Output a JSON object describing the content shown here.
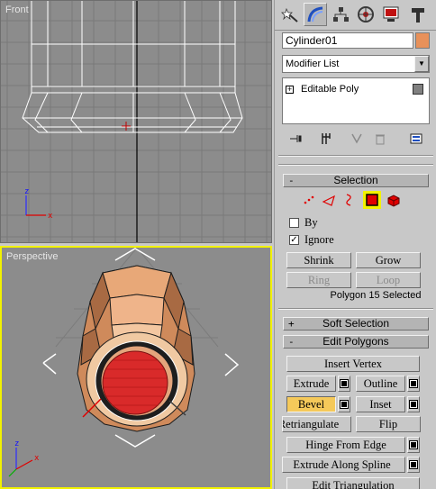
{
  "viewports": {
    "front_label": "Front",
    "perspective_label": "Perspective",
    "axis_x": "x",
    "axis_z": "z"
  },
  "command_panel": {
    "tabs": [
      {
        "name": "create",
        "icon": "star-wand-icon"
      },
      {
        "name": "modify",
        "icon": "bend-icon"
      },
      {
        "name": "hierarchy",
        "icon": "hierarchy-icon"
      },
      {
        "name": "motion",
        "icon": "motion-wheel-icon"
      },
      {
        "name": "display",
        "icon": "monitor-icon"
      },
      {
        "name": "utilities",
        "icon": "hammer-icon"
      }
    ],
    "object_name": "Cylinder01",
    "object_color": "#e8915a",
    "modifier_list": "Modifier List",
    "stack_item": "Editable Poly",
    "stack_expander": "+",
    "accent_selected": "#f2f200",
    "pressed_color": "#f5c95a"
  },
  "selection": {
    "title": "Selection",
    "sign": "-",
    "by_label": "By",
    "ignore_label": "Ignore",
    "by_checked": false,
    "ignore_checked": true,
    "ignore_mark": "✓",
    "shrink": "Shrink",
    "grow": "Grow",
    "ring": "Ring",
    "loop": "Loop",
    "status": "Polygon 15 Selected"
  },
  "soft_selection": {
    "title": "Soft Selection",
    "sign": "+"
  },
  "edit_polygons": {
    "title": "Edit Polygons",
    "sign": "-",
    "insert_vertex": "Insert Vertex",
    "extrude": "Extrude",
    "outline": "Outline",
    "bevel": "Bevel",
    "inset": "Inset",
    "retriangulate": "Retriangulate",
    "flip": "Flip",
    "hinge_from_edge": "Hinge From Edge",
    "extrude_along_spline": "Extrude Along Spline",
    "edit_triangulation": "Edit Triangulation"
  }
}
